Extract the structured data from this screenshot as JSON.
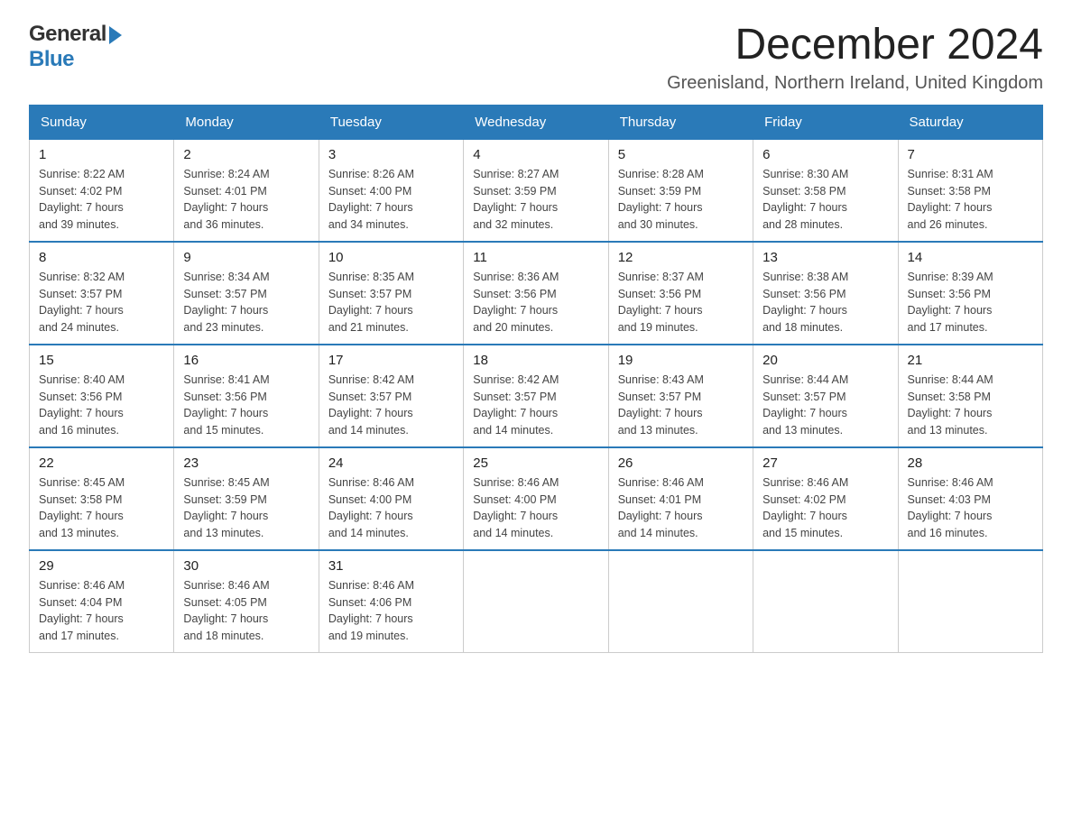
{
  "header": {
    "logo_general": "General",
    "logo_blue": "Blue",
    "month_title": "December 2024",
    "subtitle": "Greenisland, Northern Ireland, United Kingdom"
  },
  "days_of_week": [
    "Sunday",
    "Monday",
    "Tuesday",
    "Wednesday",
    "Thursday",
    "Friday",
    "Saturday"
  ],
  "weeks": [
    [
      {
        "day": "1",
        "sunrise": "8:22 AM",
        "sunset": "4:02 PM",
        "daylight": "7 hours and 39 minutes."
      },
      {
        "day": "2",
        "sunrise": "8:24 AM",
        "sunset": "4:01 PM",
        "daylight": "7 hours and 36 minutes."
      },
      {
        "day": "3",
        "sunrise": "8:26 AM",
        "sunset": "4:00 PM",
        "daylight": "7 hours and 34 minutes."
      },
      {
        "day": "4",
        "sunrise": "8:27 AM",
        "sunset": "3:59 PM",
        "daylight": "7 hours and 32 minutes."
      },
      {
        "day": "5",
        "sunrise": "8:28 AM",
        "sunset": "3:59 PM",
        "daylight": "7 hours and 30 minutes."
      },
      {
        "day": "6",
        "sunrise": "8:30 AM",
        "sunset": "3:58 PM",
        "daylight": "7 hours and 28 minutes."
      },
      {
        "day": "7",
        "sunrise": "8:31 AM",
        "sunset": "3:58 PM",
        "daylight": "7 hours and 26 minutes."
      }
    ],
    [
      {
        "day": "8",
        "sunrise": "8:32 AM",
        "sunset": "3:57 PM",
        "daylight": "7 hours and 24 minutes."
      },
      {
        "day": "9",
        "sunrise": "8:34 AM",
        "sunset": "3:57 PM",
        "daylight": "7 hours and 23 minutes."
      },
      {
        "day": "10",
        "sunrise": "8:35 AM",
        "sunset": "3:57 PM",
        "daylight": "7 hours and 21 minutes."
      },
      {
        "day": "11",
        "sunrise": "8:36 AM",
        "sunset": "3:56 PM",
        "daylight": "7 hours and 20 minutes."
      },
      {
        "day": "12",
        "sunrise": "8:37 AM",
        "sunset": "3:56 PM",
        "daylight": "7 hours and 19 minutes."
      },
      {
        "day": "13",
        "sunrise": "8:38 AM",
        "sunset": "3:56 PM",
        "daylight": "7 hours and 18 minutes."
      },
      {
        "day": "14",
        "sunrise": "8:39 AM",
        "sunset": "3:56 PM",
        "daylight": "7 hours and 17 minutes."
      }
    ],
    [
      {
        "day": "15",
        "sunrise": "8:40 AM",
        "sunset": "3:56 PM",
        "daylight": "7 hours and 16 minutes."
      },
      {
        "day": "16",
        "sunrise": "8:41 AM",
        "sunset": "3:56 PM",
        "daylight": "7 hours and 15 minutes."
      },
      {
        "day": "17",
        "sunrise": "8:42 AM",
        "sunset": "3:57 PM",
        "daylight": "7 hours and 14 minutes."
      },
      {
        "day": "18",
        "sunrise": "8:42 AM",
        "sunset": "3:57 PM",
        "daylight": "7 hours and 14 minutes."
      },
      {
        "day": "19",
        "sunrise": "8:43 AM",
        "sunset": "3:57 PM",
        "daylight": "7 hours and 13 minutes."
      },
      {
        "day": "20",
        "sunrise": "8:44 AM",
        "sunset": "3:57 PM",
        "daylight": "7 hours and 13 minutes."
      },
      {
        "day": "21",
        "sunrise": "8:44 AM",
        "sunset": "3:58 PM",
        "daylight": "7 hours and 13 minutes."
      }
    ],
    [
      {
        "day": "22",
        "sunrise": "8:45 AM",
        "sunset": "3:58 PM",
        "daylight": "7 hours and 13 minutes."
      },
      {
        "day": "23",
        "sunrise": "8:45 AM",
        "sunset": "3:59 PM",
        "daylight": "7 hours and 13 minutes."
      },
      {
        "day": "24",
        "sunrise": "8:46 AM",
        "sunset": "4:00 PM",
        "daylight": "7 hours and 14 minutes."
      },
      {
        "day": "25",
        "sunrise": "8:46 AM",
        "sunset": "4:00 PM",
        "daylight": "7 hours and 14 minutes."
      },
      {
        "day": "26",
        "sunrise": "8:46 AM",
        "sunset": "4:01 PM",
        "daylight": "7 hours and 14 minutes."
      },
      {
        "day": "27",
        "sunrise": "8:46 AM",
        "sunset": "4:02 PM",
        "daylight": "7 hours and 15 minutes."
      },
      {
        "day": "28",
        "sunrise": "8:46 AM",
        "sunset": "4:03 PM",
        "daylight": "7 hours and 16 minutes."
      }
    ],
    [
      {
        "day": "29",
        "sunrise": "8:46 AM",
        "sunset": "4:04 PM",
        "daylight": "7 hours and 17 minutes."
      },
      {
        "day": "30",
        "sunrise": "8:46 AM",
        "sunset": "4:05 PM",
        "daylight": "7 hours and 18 minutes."
      },
      {
        "day": "31",
        "sunrise": "8:46 AM",
        "sunset": "4:06 PM",
        "daylight": "7 hours and 19 minutes."
      },
      null,
      null,
      null,
      null
    ]
  ],
  "labels": {
    "sunrise": "Sunrise:",
    "sunset": "Sunset:",
    "daylight": "Daylight:"
  }
}
